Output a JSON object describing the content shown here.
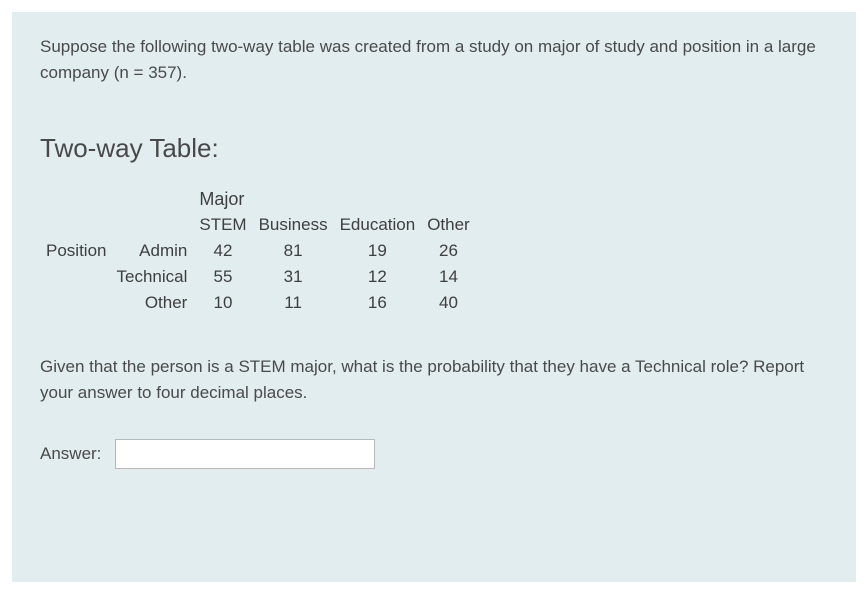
{
  "intro": "Suppose the following two-way table was created from a study on major of study and position in a large company (n = 357).",
  "heading": "Two-way Table:",
  "table": {
    "top_header": "Major",
    "col_headers": [
      "STEM",
      "Business",
      "Education",
      "Other"
    ],
    "row_group_label": "Position",
    "rows": [
      {
        "label": "Admin",
        "values": [
          "42",
          "81",
          "19",
          "26"
        ]
      },
      {
        "label": "Technical",
        "values": [
          "55",
          "31",
          "12",
          "14"
        ]
      },
      {
        "label": "Other",
        "values": [
          "10",
          "11",
          "16",
          "40"
        ]
      }
    ]
  },
  "followup": "Given that the person is a STEM major, what is the probability that they have a Technical role?  Report your answer to four decimal places.",
  "answer": {
    "label": "Answer:",
    "value": ""
  }
}
